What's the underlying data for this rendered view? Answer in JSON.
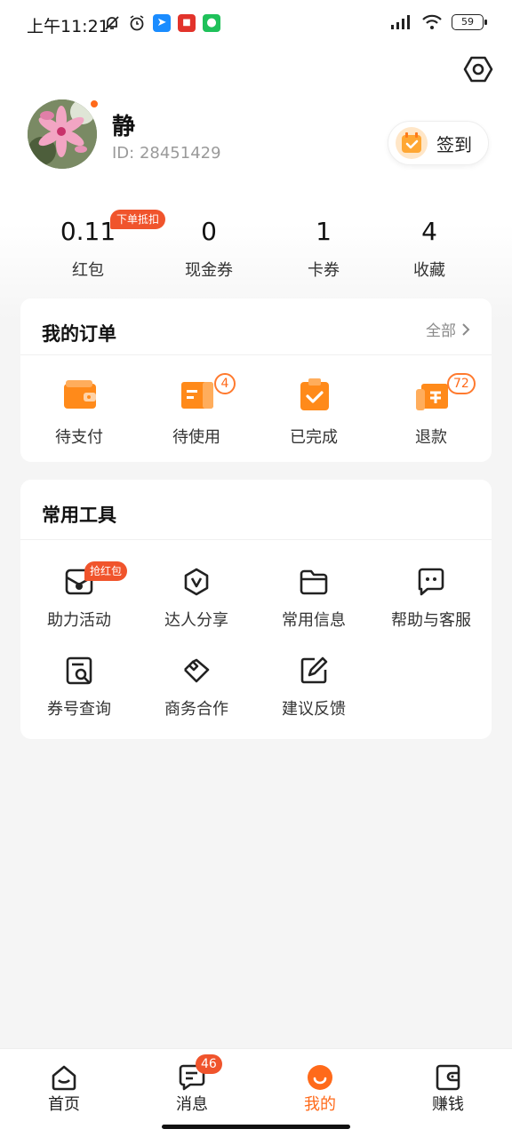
{
  "status_bar": {
    "time": "上午11:21",
    "battery": "59",
    "left_icons": [
      "bell-off-icon",
      "alarm-icon",
      "blue-app-icon",
      "red-app-icon",
      "wechat-icon"
    ],
    "right_icons": [
      "signal-icon",
      "wifi-icon",
      "battery-icon"
    ]
  },
  "profile": {
    "name": "静",
    "id_text": "ID: 28451429",
    "signin_label": "签到"
  },
  "stats": [
    {
      "value": "0.11",
      "label": "红包",
      "badge": "下单抵扣"
    },
    {
      "value": "0",
      "label": "现金券"
    },
    {
      "value": "1",
      "label": "卡券"
    },
    {
      "value": "4",
      "label": "收藏"
    }
  ],
  "orders": {
    "title": "我的订单",
    "more_label": "全部",
    "items": [
      {
        "label": "待支付",
        "icon": "wallet-icon"
      },
      {
        "label": "待使用",
        "icon": "ticket-icon",
        "badge": "4"
      },
      {
        "label": "已完成",
        "icon": "clipboard-check-icon"
      },
      {
        "label": "退款",
        "icon": "refund-icon",
        "badge": "72"
      }
    ]
  },
  "tools": {
    "title": "常用工具",
    "items": [
      {
        "label": "助力活动",
        "icon": "mail-coin-icon",
        "badge": "抢红包"
      },
      {
        "label": "达人分享",
        "icon": "hexagon-v-icon"
      },
      {
        "label": "常用信息",
        "icon": "folder-icon"
      },
      {
        "label": "帮助与客服",
        "icon": "chat-icon"
      },
      {
        "label": "券号查询",
        "icon": "receipt-search-icon"
      },
      {
        "label": "商务合作",
        "icon": "handshake-icon"
      },
      {
        "label": "建议反馈",
        "icon": "edit-icon"
      }
    ]
  },
  "tabbar": {
    "items": [
      {
        "label": "首页",
        "icon": "home-icon"
      },
      {
        "label": "消息",
        "icon": "message-icon",
        "badge": "46"
      },
      {
        "label": "我的",
        "icon": "smile-icon",
        "active": true
      },
      {
        "label": "赚钱",
        "icon": "wallet-icon"
      }
    ]
  },
  "colors": {
    "accent": "#ff6a1a",
    "badge_red": "#f0542c",
    "background": "#f5f5f5"
  }
}
